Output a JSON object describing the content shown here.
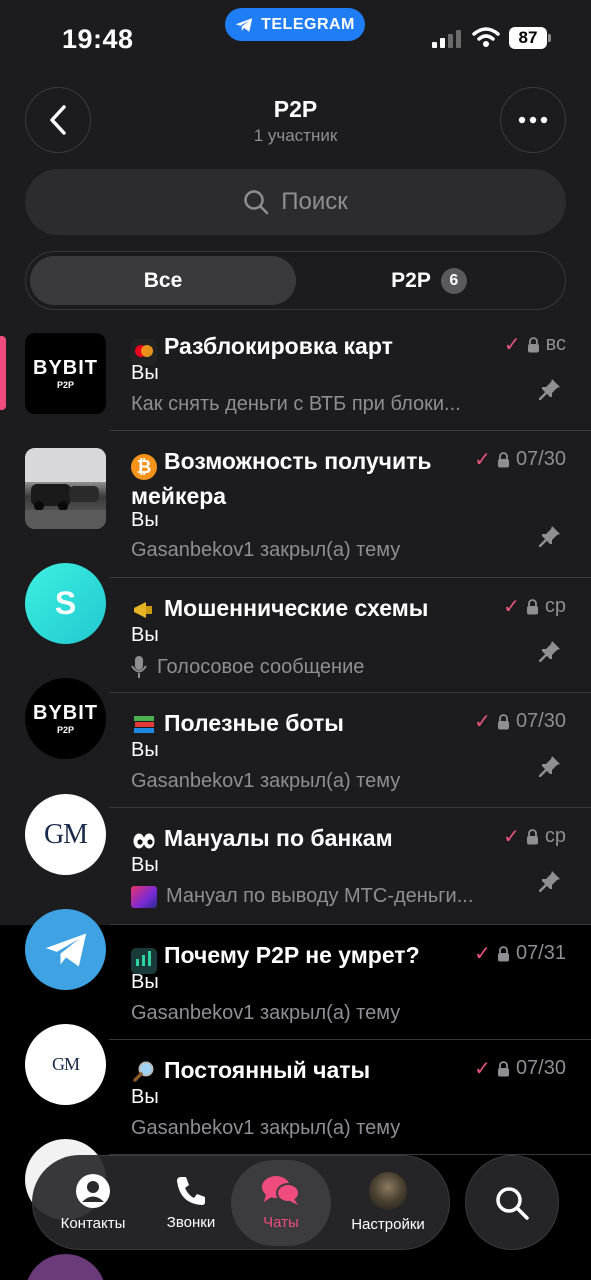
{
  "status_bar": {
    "time": "19:48",
    "app_pill": "TELEGRAM",
    "battery": "87"
  },
  "header": {
    "title": "P2P",
    "subtitle": "1 участник"
  },
  "search": {
    "placeholder": "Поиск"
  },
  "tabs": [
    {
      "label": "Все",
      "active": true
    },
    {
      "label": "P2P",
      "badge": "6"
    }
  ],
  "topics": [
    {
      "title": "Разблокировка карт",
      "sender": "Вы",
      "preview": "Как снять деньги с ВТБ при блоки...",
      "date": "вс",
      "pinned": true,
      "icon": "mastercard-icon"
    },
    {
      "title": "Возможность получить мейкера",
      "sender": "Вы",
      "preview": "Gasanbekov1 закрыл(а) тему",
      "date": "07/30",
      "pinned": true,
      "icon": "bitcoin-icon"
    },
    {
      "title": "Мошеннические схемы",
      "sender": "Вы",
      "preview": "Голосовое сообщение",
      "date": "ср",
      "pinned": true,
      "icon": "megaphone-icon"
    },
    {
      "title": "Полезные боты",
      "sender": "Вы",
      "preview": "Gasanbekov1 закрыл(а) тему",
      "date": "07/30",
      "pinned": true,
      "icon": "books-icon"
    },
    {
      "title": "Мануалы по банкам",
      "sender": "Вы",
      "preview": "Мануал по выводу МТС-деньги...",
      "date": "ср",
      "pinned": true,
      "icon": "eyes-icon"
    },
    {
      "title": "Почему P2P не умрет?",
      "sender": "Вы",
      "preview": "Gasanbekov1 закрыл(а) тему",
      "date": "07/31",
      "pinned": false,
      "icon": "chart-icon"
    },
    {
      "title": "Постоянный чаты",
      "sender": "Вы",
      "preview": "Gasanbekov1 закрыл(а) тему",
      "date": "07/30",
      "pinned": false,
      "icon": "magnifier-icon"
    }
  ],
  "sidebar_chats": [
    {
      "name": "BYBIT",
      "sub": "P2P"
    },
    {
      "name": "car-photo"
    },
    {
      "name": "S"
    },
    {
      "name": "BYBIT",
      "sub": "P2P"
    },
    {
      "name": "GM"
    },
    {
      "name": "telegram"
    },
    {
      "name": "GM"
    }
  ],
  "tab_bar": [
    {
      "label": "Контакты"
    },
    {
      "label": "Звонки"
    },
    {
      "label": "Чаты",
      "active": true
    },
    {
      "label": "Настройки"
    }
  ],
  "colors": {
    "accent": "#1f7ef5",
    "pink": "#ef4b7d",
    "check": "#e8557e"
  }
}
